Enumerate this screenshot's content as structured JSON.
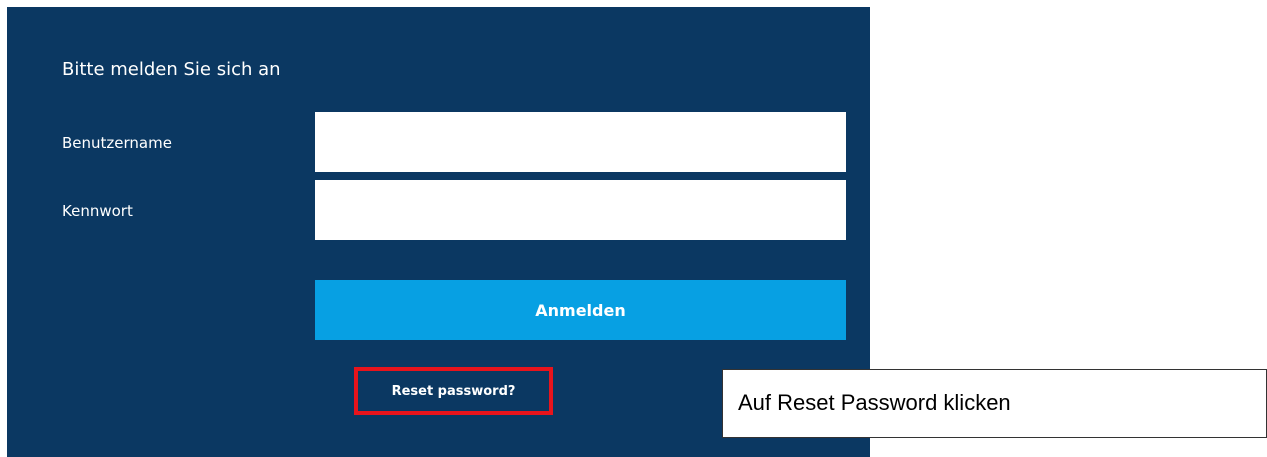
{
  "panel_bg_color": "#0b3862",
  "accent_color": "#07a0e3",
  "highlight_color": "#e8141c",
  "login": {
    "prompt": "Bitte melden Sie sich an",
    "username_label": "Benutzername",
    "password_label": "Kennwort",
    "username_value": "",
    "password_value": "",
    "submit_label": "Anmelden",
    "reset_link": "Reset password?"
  },
  "annotation": {
    "callout_text": "Auf Reset Password klicken"
  }
}
